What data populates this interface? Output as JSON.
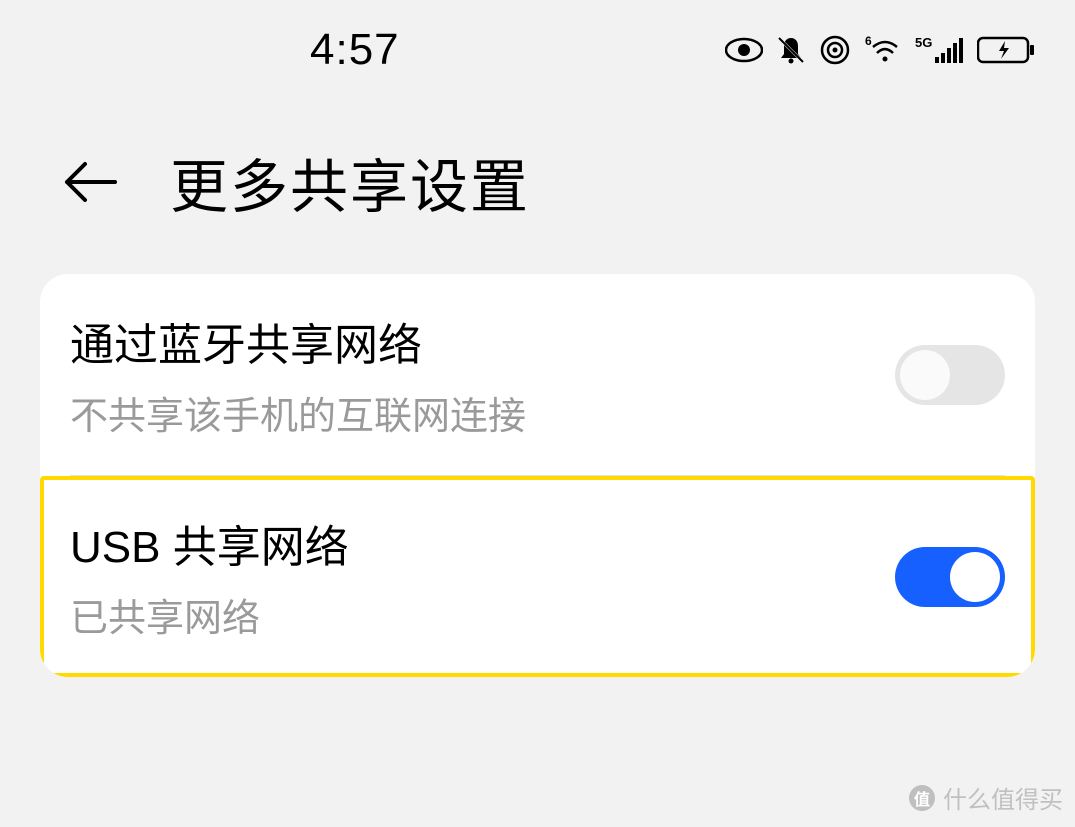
{
  "status": {
    "time": "4:57",
    "network_indicator_1": "6",
    "network_indicator_2": "5G"
  },
  "header": {
    "title": "更多共享设置"
  },
  "settings": [
    {
      "title": "通过蓝牙共享网络",
      "subtitle": "不共享该手机的互联网连接",
      "enabled": false
    },
    {
      "title": "USB 共享网络",
      "subtitle": "已共享网络",
      "enabled": true,
      "highlighted": true
    }
  ],
  "watermark": {
    "badge": "值",
    "text": "什么值得买"
  }
}
